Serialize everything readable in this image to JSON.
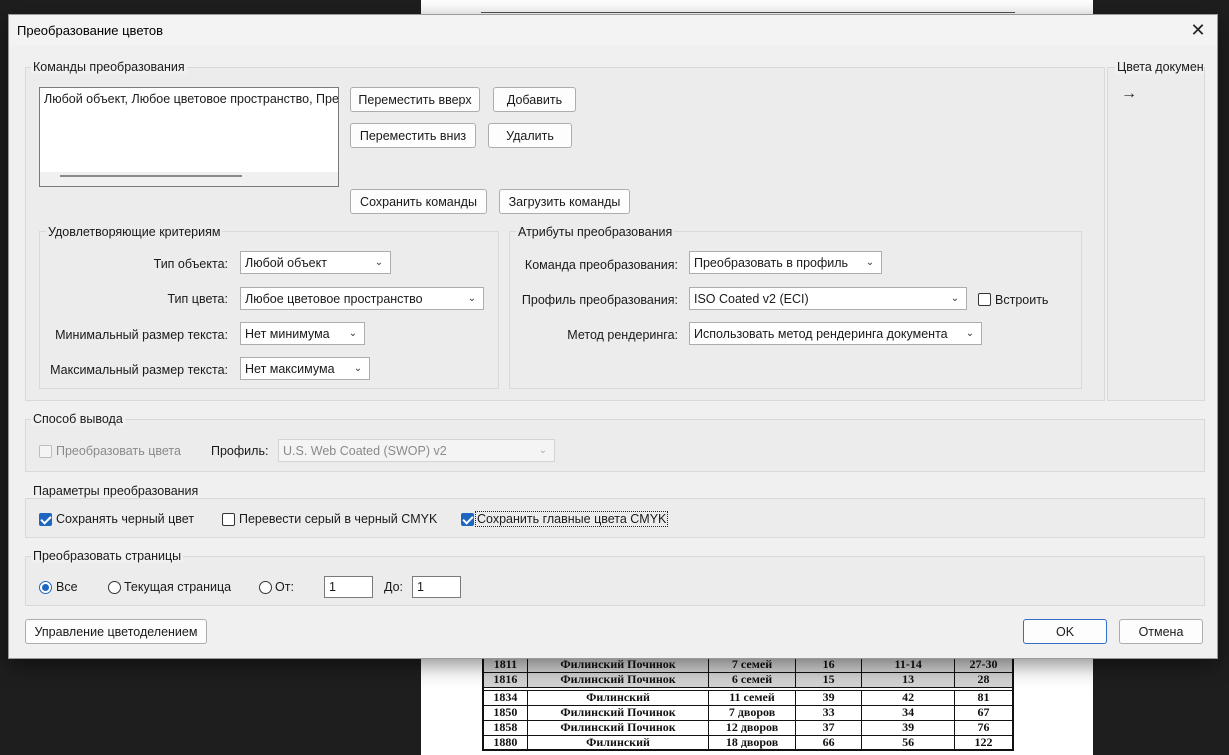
{
  "dialog": {
    "title": "Преобразование цветов",
    "close_glyph": "✕"
  },
  "commands": {
    "legend": "Команды преобразования",
    "list_item": "Любой объект, Любое цветовое пространство, Преобразовать в профиль",
    "move_up": "Переместить вверх",
    "move_down": "Переместить вниз",
    "add": "Добавить",
    "remove": "Удалить",
    "save": "Сохранить команды",
    "load": "Загрузить команды"
  },
  "criteria": {
    "legend": "Удовлетворяющие критериям",
    "object_type_label": "Тип объекта:",
    "object_type_value": "Любой объект",
    "color_type_label": "Тип цвета:",
    "color_type_value": "Любое цветовое пространство",
    "min_text_label": "Минимальный размер текста:",
    "min_text_value": "Нет минимума",
    "max_text_label": "Максимальный размер текста:",
    "max_text_value": "Нет максимума"
  },
  "attributes": {
    "legend": "Атрибуты преобразования",
    "command_label": "Команда преобразования:",
    "command_value": "Преобразовать в профиль",
    "profile_label": "Профиль преобразования:",
    "profile_value": "ISO Coated v2 (ECI)",
    "embed_label": "Встроить",
    "embed_checked": false,
    "render_label": "Метод рендеринга:",
    "render_value": "Использовать метод рендеринга документа"
  },
  "doc_colors": {
    "legend": "Цвета документ",
    "arrow_icon": "→"
  },
  "output": {
    "legend": "Способ вывода",
    "convert_label": "Преобразовать цвета",
    "convert_checked": false,
    "profile_label": "Профиль:",
    "profile_value": "U.S. Web Coated (SWOP) v2"
  },
  "params": {
    "legend": "Параметры преобразования",
    "keep_black": "Сохранять черный цвет",
    "keep_black_checked": true,
    "gray_to_black": "Перевести серый в черный CMYK",
    "gray_to_black_checked": false,
    "keep_primaries": "Сохранить главные цвета CMYK",
    "keep_primaries_checked": true
  },
  "pages": {
    "legend": "Преобразовать страницы",
    "all": "Все",
    "current": "Текущая страница",
    "from_label": "От:",
    "from_value": "1",
    "to_label": "До:",
    "to_value": "1",
    "selected": "all"
  },
  "footer": {
    "separation_button": "Управление цветоделением",
    "ok": "OK",
    "cancel": "Отмена"
  },
  "doc_table": {
    "rows": [
      {
        "year": "1811",
        "name": "Филинский Починок",
        "households": "7 семей",
        "c1": "16",
        "c2": "11-14",
        "c3": "27-30",
        "shaded": true
      },
      {
        "year": "1816",
        "name": "Филинский Починок",
        "households": "6 семей",
        "c1": "15",
        "c2": "13",
        "c3": "28",
        "shaded": true
      },
      {
        "year": "1834",
        "name": "Филинский",
        "households": "11 семей",
        "c1": "39",
        "c2": "42",
        "c3": "81",
        "shaded": false
      },
      {
        "year": "1850",
        "name": "Филинский Починок",
        "households": "7 дворов",
        "c1": "33",
        "c2": "34",
        "c3": "67",
        "shaded": false
      },
      {
        "year": "1858",
        "name": "Филинский Починок",
        "households": "12 дворов",
        "c1": "37",
        "c2": "39",
        "c3": "76",
        "shaded": false
      },
      {
        "year": "1880",
        "name": "Филинский",
        "households": "18 дворов",
        "c1": "66",
        "c2": "56",
        "c3": "122",
        "shaded": false
      }
    ]
  }
}
